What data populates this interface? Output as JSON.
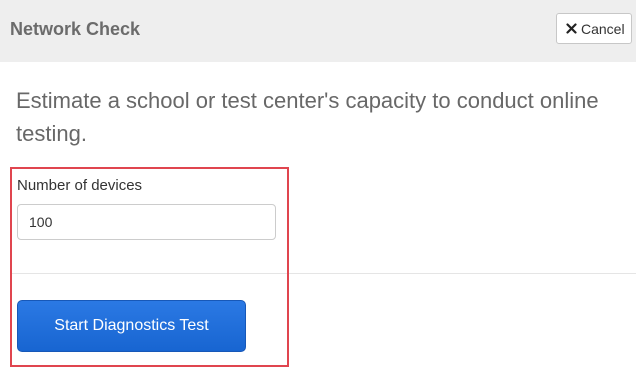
{
  "header": {
    "title": "Network Check",
    "cancel_label": "Cancel",
    "cancel_icon": "close-icon"
  },
  "intro": {
    "text": "Estimate a school or test center's capacity to conduct online testing."
  },
  "form": {
    "devices_label": "Number of devices",
    "devices_value": "100",
    "start_button_label": "Start Diagnostics Test"
  },
  "colors": {
    "header_bg": "#eeeeee",
    "primary_button": "#1e6fdc",
    "highlight_border": "#e0454f"
  }
}
